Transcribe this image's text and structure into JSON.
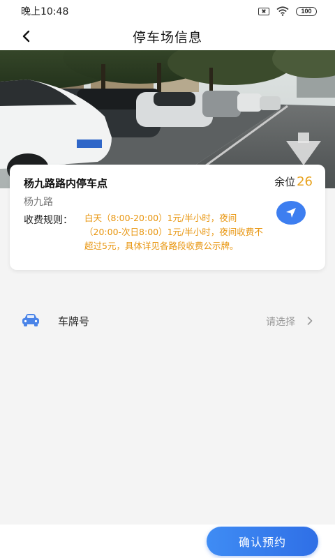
{
  "status_bar": {
    "time": "晚上10:48",
    "battery": "100"
  },
  "header": {
    "title": "停车场信息"
  },
  "lot": {
    "name": "杨九路路内停车点",
    "spaces_label": "余位",
    "spaces_count": "26",
    "address": "杨九路",
    "fee_label": "收费规则：",
    "fee_rule": "白天（8:00-20:00）1元/半小时，夜间（20:00-次日8:00）1元/半小时，夜间收费不超过5元，具体详见各路段收费公示牌。"
  },
  "plate": {
    "label": "车牌号",
    "placeholder": "请选择"
  },
  "footer": {
    "confirm_label": "确认预约"
  },
  "colors": {
    "accent": "#3d7ef0",
    "highlight": "#e8a21d"
  }
}
